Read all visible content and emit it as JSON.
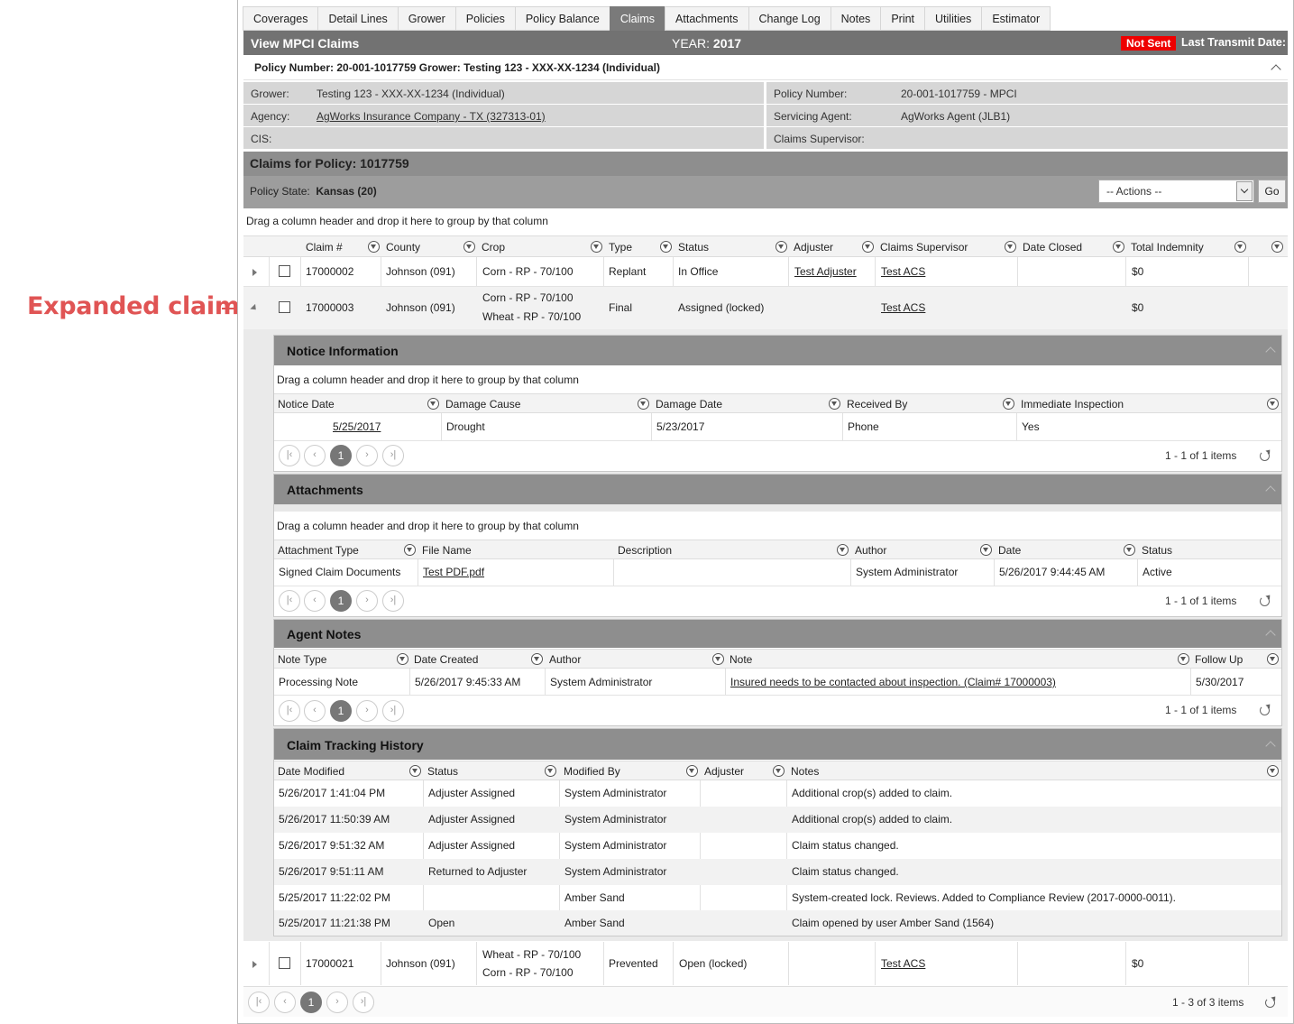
{
  "callout": "Expanded claim",
  "tabs": [
    "Coverages",
    "Detail Lines",
    "Grower",
    "Policies",
    "Policy Balance",
    "Claims",
    "Attachments",
    "Change Log",
    "Notes",
    "Print",
    "Utilities",
    "Estimator"
  ],
  "title": "View MPCI Claims",
  "year_label": "YEAR:",
  "year": "2017",
  "not_sent": "Not Sent",
  "last_transmit": "Last Transmit Date:",
  "policy_header": "Policy Number: 20-001-1017759 Grower: Testing 123 - XXX-XX-1234 (Individual)",
  "info": {
    "grower_label": "Grower:",
    "grower": "Testing 123 - XXX-XX-1234 (Individual)",
    "policy_number_label": "Policy Number:",
    "policy_number": "20-001-1017759 - MPCI",
    "agency_label": "Agency:",
    "agency": "AgWorks Insurance Company - TX (327313-01)",
    "servicing_agent_label": "Servicing Agent:",
    "servicing_agent": "AgWorks Agent (JLB1)",
    "cis_label": "CIS:",
    "claims_supervisor_label": "Claims Supervisor:"
  },
  "claims_title": "Claims for Policy: 1017759",
  "policy_state_label": "Policy State:",
  "policy_state": "Kansas (20)",
  "actions_select": "-- Actions --",
  "go": "Go",
  "group_hint": "Drag a column header and drop it here to group by that column",
  "claims_columns": [
    "Claim #",
    "County",
    "Crop",
    "Type",
    "Status",
    "Adjuster",
    "Claims Supervisor",
    "Date Closed",
    "Total Indemnity"
  ],
  "claims": [
    {
      "claim": "17000002",
      "county": "Johnson (091)",
      "crop1": "Corn - RP - 70/100",
      "crop2": "",
      "type": "Replant",
      "status": "In Office",
      "adjuster": "Test Adjuster",
      "supervisor": "Test ACS",
      "closed": "",
      "indemnity": "$0"
    },
    {
      "claim": "17000003",
      "county": "Johnson (091)",
      "crop1": "Corn - RP - 70/100",
      "crop2": "Wheat - RP - 70/100",
      "type": "Final",
      "status": "Assigned (locked)",
      "adjuster": "",
      "supervisor": "Test ACS",
      "closed": "",
      "indemnity": "$0"
    },
    {
      "claim": "17000021",
      "county": "Johnson (091)",
      "crop1": "Wheat - RP - 70/100",
      "crop2": "Corn - RP - 70/100",
      "type": "Prevented",
      "status": "Open (locked)",
      "adjuster": "",
      "supervisor": "Test ACS",
      "closed": "",
      "indemnity": "$0"
    }
  ],
  "notice": {
    "title": "Notice Information",
    "columns": [
      "Notice Date",
      "Damage Cause",
      "Damage Date",
      "Received By",
      "Immediate Inspection"
    ],
    "row": [
      "5/25/2017",
      "Drought",
      "5/23/2017",
      "Phone",
      "Yes"
    ],
    "page": "1",
    "info": "1 - 1 of 1 items"
  },
  "attachments": {
    "title": "Attachments",
    "columns": [
      "Attachment Type",
      "File Name",
      "Description",
      "Author",
      "Date",
      "Status"
    ],
    "row": [
      "Signed Claim Documents",
      "Test PDF.pdf",
      "",
      "System Administrator",
      "5/26/2017 9:44:45 AM",
      "Active"
    ],
    "page": "1",
    "info": "1 - 1 of 1 items"
  },
  "agent_notes": {
    "title": "Agent Notes",
    "columns": [
      "Note Type",
      "Date Created",
      "Author",
      "Note",
      "Follow Up"
    ],
    "row": [
      "Processing Note",
      "5/26/2017 9:45:33 AM",
      "System Administrator",
      "Insured needs to be contacted about inspection. (Claim# 17000003)",
      "5/30/2017"
    ],
    "page": "1",
    "info": "1 - 1 of 1 items"
  },
  "tracking": {
    "title": "Claim Tracking History",
    "columns": [
      "Date Modified",
      "Status",
      "Modified By",
      "Adjuster",
      "Notes"
    ],
    "rows": [
      [
        "5/26/2017 1:41:04 PM",
        "Adjuster Assigned",
        "System Administrator",
        "",
        "Additional crop(s) added to claim."
      ],
      [
        "5/26/2017 11:50:39 AM",
        "Adjuster Assigned",
        "System Administrator",
        "",
        "Additional crop(s) added to claim."
      ],
      [
        "5/26/2017 9:51:32 AM",
        "Adjuster Assigned",
        "System Administrator",
        "",
        "Claim status changed."
      ],
      [
        "5/26/2017 9:51:11 AM",
        "Returned to Adjuster",
        "System Administrator",
        "",
        "Claim status changed."
      ],
      [
        "5/25/2017 11:22:02 PM",
        "",
        "Amber Sand",
        "",
        "System-created lock. Reviews. Added to Compliance Review (2017-0000-0011)."
      ],
      [
        "5/25/2017 11:21:38 PM",
        "Open",
        "Amber Sand",
        "",
        "Claim opened by user Amber Sand (1564)"
      ]
    ]
  },
  "main_pager": {
    "page": "1",
    "info": "1 - 3 of 3 items"
  }
}
